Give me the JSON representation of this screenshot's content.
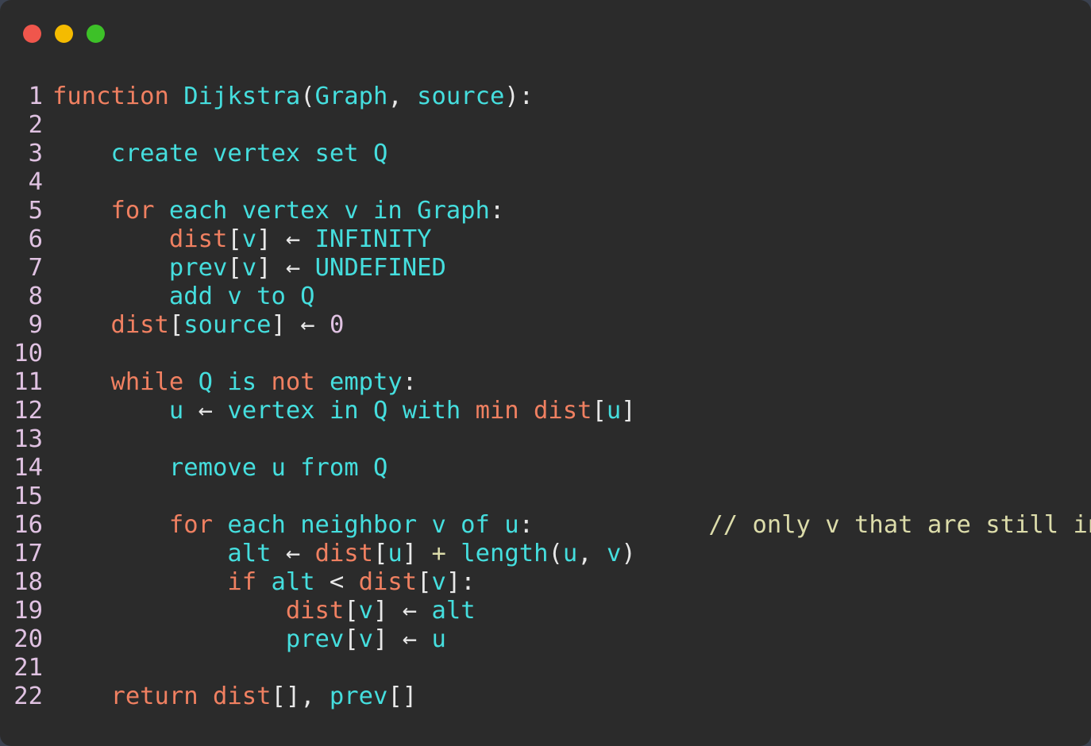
{
  "window": {
    "background_color": "#2b2b2b",
    "page_background_color": "#3b4250",
    "controls": [
      {
        "name": "close",
        "color": "#f0564c"
      },
      {
        "name": "minimize",
        "color": "#f5bb00"
      },
      {
        "name": "maximize",
        "color": "#3dc128"
      }
    ]
  },
  "theme": {
    "keyword_color": "#f08061",
    "identifier_color": "#45dede",
    "punctuation_color": "#e8e8e8",
    "number_color": "#e0c2e2",
    "comment_color": "#dcdcaa",
    "linenumber_color": "#e0c2e2"
  },
  "editor": {
    "language": "pseudocode",
    "total_lines": 22,
    "lines": [
      {
        "number": "1",
        "text": "function Dijkstra(Graph, source):",
        "tokens": [
          {
            "t": "function",
            "c": "kw"
          },
          {
            "t": " ",
            "c": "punct"
          },
          {
            "t": "Dijkstra",
            "c": "id"
          },
          {
            "t": "(",
            "c": "punct"
          },
          {
            "t": "Graph",
            "c": "id"
          },
          {
            "t": ", ",
            "c": "punct"
          },
          {
            "t": "source",
            "c": "id"
          },
          {
            "t": "):",
            "c": "punct"
          }
        ]
      },
      {
        "number": "2",
        "text": "",
        "tokens": []
      },
      {
        "number": "3",
        "text": "    create vertex set Q",
        "tokens": [
          {
            "t": "    ",
            "c": "punct"
          },
          {
            "t": "create vertex set Q",
            "c": "id"
          }
        ]
      },
      {
        "number": "4",
        "text": "",
        "tokens": []
      },
      {
        "number": "5",
        "text": "    for each vertex v in Graph:",
        "tokens": [
          {
            "t": "    ",
            "c": "punct"
          },
          {
            "t": "for",
            "c": "kw"
          },
          {
            "t": " ",
            "c": "punct"
          },
          {
            "t": "each vertex v in Graph",
            "c": "id"
          },
          {
            "t": ":",
            "c": "punct"
          }
        ]
      },
      {
        "number": "6",
        "text": "        dist[v] ← INFINITY",
        "tokens": [
          {
            "t": "        ",
            "c": "punct"
          },
          {
            "t": "dist",
            "c": "kw"
          },
          {
            "t": "[",
            "c": "punct"
          },
          {
            "t": "v",
            "c": "id"
          },
          {
            "t": "] ",
            "c": "punct"
          },
          {
            "t": "←",
            "c": "arrow"
          },
          {
            "t": " ",
            "c": "punct"
          },
          {
            "t": "INFINITY",
            "c": "id"
          }
        ]
      },
      {
        "number": "7",
        "text": "        prev[v] ← UNDEFINED",
        "tokens": [
          {
            "t": "        ",
            "c": "punct"
          },
          {
            "t": "prev",
            "c": "id"
          },
          {
            "t": "[",
            "c": "punct"
          },
          {
            "t": "v",
            "c": "id"
          },
          {
            "t": "] ",
            "c": "punct"
          },
          {
            "t": "←",
            "c": "arrow"
          },
          {
            "t": " ",
            "c": "punct"
          },
          {
            "t": "UNDEFINED",
            "c": "id"
          }
        ]
      },
      {
        "number": "8",
        "text": "        add v to Q",
        "tokens": [
          {
            "t": "        ",
            "c": "punct"
          },
          {
            "t": "add v to Q",
            "c": "id"
          }
        ]
      },
      {
        "number": "9",
        "text": "    dist[source] ← 0",
        "tokens": [
          {
            "t": "    ",
            "c": "punct"
          },
          {
            "t": "dist",
            "c": "kw"
          },
          {
            "t": "[",
            "c": "punct"
          },
          {
            "t": "source",
            "c": "id"
          },
          {
            "t": "] ",
            "c": "punct"
          },
          {
            "t": "←",
            "c": "arrow"
          },
          {
            "t": " ",
            "c": "punct"
          },
          {
            "t": "0",
            "c": "num"
          }
        ]
      },
      {
        "number": "10",
        "text": "",
        "tokens": []
      },
      {
        "number": "11",
        "text": "    while Q is not empty:",
        "tokens": [
          {
            "t": "    ",
            "c": "punct"
          },
          {
            "t": "while",
            "c": "kw"
          },
          {
            "t": " ",
            "c": "punct"
          },
          {
            "t": "Q is ",
            "c": "id"
          },
          {
            "t": "not",
            "c": "kw"
          },
          {
            "t": " ",
            "c": "punct"
          },
          {
            "t": "empty",
            "c": "id"
          },
          {
            "t": ":",
            "c": "punct"
          }
        ]
      },
      {
        "number": "12",
        "text": "        u ← vertex in Q with min dist[u]",
        "tokens": [
          {
            "t": "        ",
            "c": "punct"
          },
          {
            "t": "u",
            "c": "id"
          },
          {
            "t": " ",
            "c": "punct"
          },
          {
            "t": "←",
            "c": "arrow"
          },
          {
            "t": " ",
            "c": "punct"
          },
          {
            "t": "vertex in Q with ",
            "c": "id"
          },
          {
            "t": "min",
            "c": "kw"
          },
          {
            "t": " ",
            "c": "punct"
          },
          {
            "t": "dist",
            "c": "kw"
          },
          {
            "t": "[",
            "c": "punct"
          },
          {
            "t": "u",
            "c": "id"
          },
          {
            "t": "]",
            "c": "punct"
          }
        ]
      },
      {
        "number": "13",
        "text": "",
        "tokens": []
      },
      {
        "number": "14",
        "text": "        remove u from Q",
        "tokens": [
          {
            "t": "        ",
            "c": "punct"
          },
          {
            "t": "remove u from Q",
            "c": "id"
          }
        ]
      },
      {
        "number": "15",
        "text": "",
        "tokens": []
      },
      {
        "number": "16",
        "text": "        for each neighbor v of u:            // only v that are still in Q",
        "tokens": [
          {
            "t": "        ",
            "c": "punct"
          },
          {
            "t": "for",
            "c": "kw"
          },
          {
            "t": " ",
            "c": "punct"
          },
          {
            "t": "each neighbor v of u",
            "c": "id"
          },
          {
            "t": ":",
            "c": "punct"
          },
          {
            "t": "            ",
            "c": "punct"
          },
          {
            "t": "// only v that are still in Q",
            "c": "comment"
          }
        ]
      },
      {
        "number": "17",
        "text": "            alt ← dist[u] + length(u, v)",
        "tokens": [
          {
            "t": "            ",
            "c": "punct"
          },
          {
            "t": "alt",
            "c": "id"
          },
          {
            "t": " ",
            "c": "punct"
          },
          {
            "t": "←",
            "c": "arrow"
          },
          {
            "t": " ",
            "c": "punct"
          },
          {
            "t": "dist",
            "c": "kw"
          },
          {
            "t": "[",
            "c": "punct"
          },
          {
            "t": "u",
            "c": "id"
          },
          {
            "t": "] ",
            "c": "punct"
          },
          {
            "t": "+",
            "c": "op"
          },
          {
            "t": " ",
            "c": "punct"
          },
          {
            "t": "length",
            "c": "id"
          },
          {
            "t": "(",
            "c": "punct"
          },
          {
            "t": "u",
            "c": "id"
          },
          {
            "t": ", ",
            "c": "punct"
          },
          {
            "t": "v",
            "c": "id"
          },
          {
            "t": ")",
            "c": "punct"
          }
        ]
      },
      {
        "number": "18",
        "text": "            if alt < dist[v]:",
        "tokens": [
          {
            "t": "            ",
            "c": "punct"
          },
          {
            "t": "if",
            "c": "kw"
          },
          {
            "t": " ",
            "c": "punct"
          },
          {
            "t": "alt",
            "c": "id"
          },
          {
            "t": " < ",
            "c": "punct"
          },
          {
            "t": "dist",
            "c": "kw"
          },
          {
            "t": "[",
            "c": "punct"
          },
          {
            "t": "v",
            "c": "id"
          },
          {
            "t": "]:",
            "c": "punct"
          }
        ]
      },
      {
        "number": "19",
        "text": "                dist[v] ← alt",
        "tokens": [
          {
            "t": "                ",
            "c": "punct"
          },
          {
            "t": "dist",
            "c": "kw"
          },
          {
            "t": "[",
            "c": "punct"
          },
          {
            "t": "v",
            "c": "id"
          },
          {
            "t": "] ",
            "c": "punct"
          },
          {
            "t": "←",
            "c": "arrow"
          },
          {
            "t": " ",
            "c": "punct"
          },
          {
            "t": "alt",
            "c": "id"
          }
        ]
      },
      {
        "number": "20",
        "text": "                prev[v] ← u",
        "tokens": [
          {
            "t": "                ",
            "c": "punct"
          },
          {
            "t": "prev",
            "c": "id"
          },
          {
            "t": "[",
            "c": "punct"
          },
          {
            "t": "v",
            "c": "id"
          },
          {
            "t": "] ",
            "c": "punct"
          },
          {
            "t": "←",
            "c": "arrow"
          },
          {
            "t": " ",
            "c": "punct"
          },
          {
            "t": "u",
            "c": "id"
          }
        ]
      },
      {
        "number": "21",
        "text": "",
        "tokens": []
      },
      {
        "number": "22",
        "text": "    return dist[], prev[]",
        "tokens": [
          {
            "t": "    ",
            "c": "punct"
          },
          {
            "t": "return",
            "c": "kw"
          },
          {
            "t": " ",
            "c": "punct"
          },
          {
            "t": "dist",
            "c": "kw"
          },
          {
            "t": "[], ",
            "c": "punct"
          },
          {
            "t": "prev",
            "c": "id"
          },
          {
            "t": "[]",
            "c": "punct"
          }
        ]
      }
    ]
  }
}
